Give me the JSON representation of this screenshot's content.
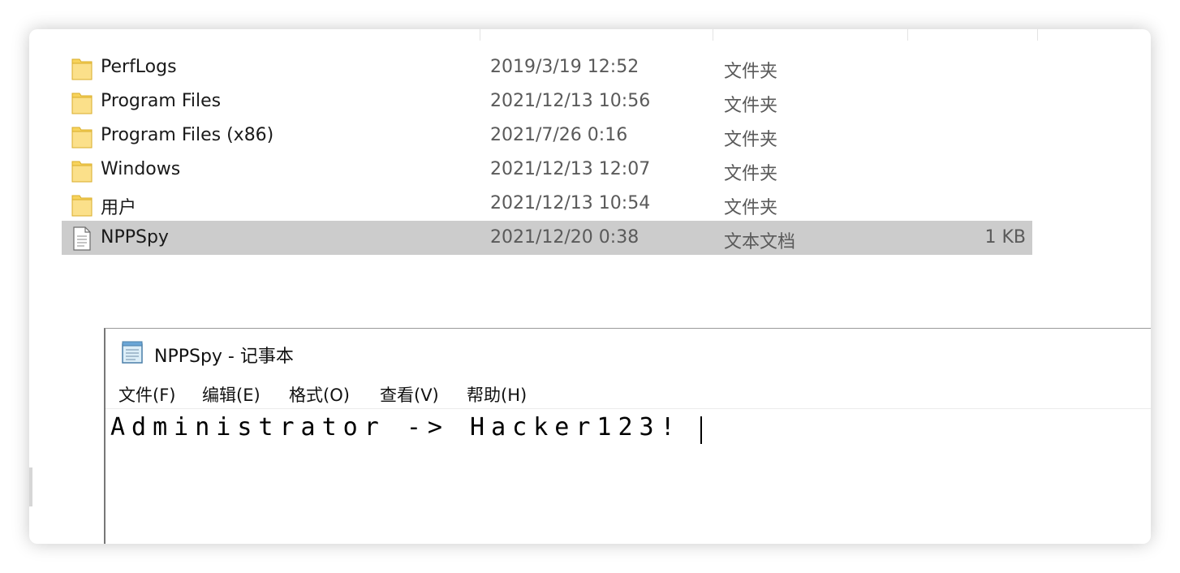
{
  "explorer": {
    "files": [
      {
        "name": "PerfLogs",
        "date": "2019/3/19 12:52",
        "type": "文件夹",
        "size": "",
        "icon": "folder-icon",
        "selected": false
      },
      {
        "name": "Program Files",
        "date": "2021/12/13 10:56",
        "type": "文件夹",
        "size": "",
        "icon": "folder-icon",
        "selected": false
      },
      {
        "name": "Program Files (x86)",
        "date": "2021/7/26 0:16",
        "type": "文件夹",
        "size": "",
        "icon": "folder-icon",
        "selected": false
      },
      {
        "name": "Windows",
        "date": "2021/12/13 12:07",
        "type": "文件夹",
        "size": "",
        "icon": "folder-icon",
        "selected": false
      },
      {
        "name": "用户",
        "date": "2021/12/13 10:54",
        "type": "文件夹",
        "size": "",
        "icon": "folder-icon",
        "selected": false
      },
      {
        "name": "NPPSpy",
        "date": "2021/12/20 0:38",
        "type": "文本文档",
        "size": "1 KB",
        "icon": "text-file-icon",
        "selected": true
      }
    ]
  },
  "notepad": {
    "title": "NPPSpy - 记事本",
    "icon": "notepad-icon",
    "menu": [
      "文件(F)",
      "编辑(E)",
      "格式(O)",
      "查看(V)",
      "帮助(H)"
    ],
    "content": "Administrator -> Hacker123!"
  },
  "colors": {
    "selection": "#cccccc",
    "folder": "#f7d35c",
    "secondary_text": "#5a5a5a"
  }
}
